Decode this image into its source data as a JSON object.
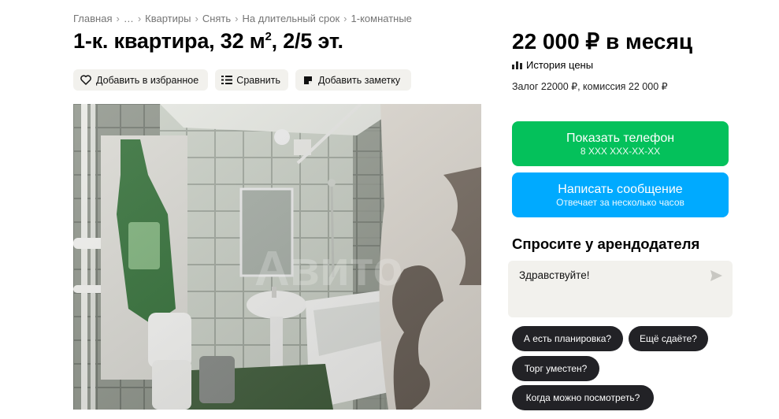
{
  "breadcrumb": [
    "Главная",
    "…",
    "Квартиры",
    "Снять",
    "На длительный срок",
    "1-комнатные"
  ],
  "listing": {
    "title_main": "1-к. квартира, 32 м",
    "title_sup": "2",
    "title_tail": ", 2/5 эт."
  },
  "actions": {
    "favorite": "Добавить в избранное",
    "compare": "Сравнить",
    "note": "Добавить заметку"
  },
  "photo": {
    "watermark": "Авито"
  },
  "price": {
    "amount": "22 000 ₽ в месяц",
    "history": "История цены",
    "deposit": "Залог 22000 ₽, комиссия 22 000 ₽"
  },
  "contact": {
    "phone_label": "Показать телефон",
    "phone_mask": "8 XXX XXX-XX-XX",
    "message_label": "Написать сообщение",
    "message_sub": "Отвечает за несколько часов"
  },
  "ask": {
    "title": "Спросите у арендодателя",
    "message": "Здравствуйте!",
    "chips": [
      "А есть планировка?",
      "Ещё сдаёте?",
      "Торг уместен?",
      "Когда можно посмотреть?"
    ]
  },
  "colors": {
    "green": "#04c15b",
    "blue": "#00aaff",
    "chip": "#222226",
    "chip_bg": "#f2f1ed"
  }
}
